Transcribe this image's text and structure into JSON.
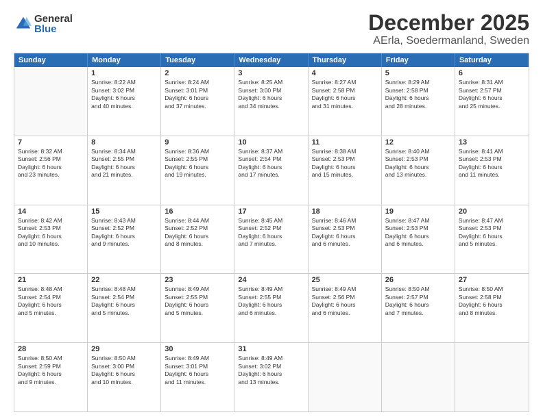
{
  "logo": {
    "general": "General",
    "blue": "Blue"
  },
  "title": "December 2025",
  "subtitle": "AErla, Soedermanland, Sweden",
  "headers": [
    "Sunday",
    "Monday",
    "Tuesday",
    "Wednesday",
    "Thursday",
    "Friday",
    "Saturday"
  ],
  "weeks": [
    [
      {
        "day": "",
        "info": ""
      },
      {
        "day": "1",
        "info": "Sunrise: 8:22 AM\nSunset: 3:02 PM\nDaylight: 6 hours\nand 40 minutes."
      },
      {
        "day": "2",
        "info": "Sunrise: 8:24 AM\nSunset: 3:01 PM\nDaylight: 6 hours\nand 37 minutes."
      },
      {
        "day": "3",
        "info": "Sunrise: 8:25 AM\nSunset: 3:00 PM\nDaylight: 6 hours\nand 34 minutes."
      },
      {
        "day": "4",
        "info": "Sunrise: 8:27 AM\nSunset: 2:58 PM\nDaylight: 6 hours\nand 31 minutes."
      },
      {
        "day": "5",
        "info": "Sunrise: 8:29 AM\nSunset: 2:58 PM\nDaylight: 6 hours\nand 28 minutes."
      },
      {
        "day": "6",
        "info": "Sunrise: 8:31 AM\nSunset: 2:57 PM\nDaylight: 6 hours\nand 25 minutes."
      }
    ],
    [
      {
        "day": "7",
        "info": "Sunrise: 8:32 AM\nSunset: 2:56 PM\nDaylight: 6 hours\nand 23 minutes."
      },
      {
        "day": "8",
        "info": "Sunrise: 8:34 AM\nSunset: 2:55 PM\nDaylight: 6 hours\nand 21 minutes."
      },
      {
        "day": "9",
        "info": "Sunrise: 8:36 AM\nSunset: 2:55 PM\nDaylight: 6 hours\nand 19 minutes."
      },
      {
        "day": "10",
        "info": "Sunrise: 8:37 AM\nSunset: 2:54 PM\nDaylight: 6 hours\nand 17 minutes."
      },
      {
        "day": "11",
        "info": "Sunrise: 8:38 AM\nSunset: 2:53 PM\nDaylight: 6 hours\nand 15 minutes."
      },
      {
        "day": "12",
        "info": "Sunrise: 8:40 AM\nSunset: 2:53 PM\nDaylight: 6 hours\nand 13 minutes."
      },
      {
        "day": "13",
        "info": "Sunrise: 8:41 AM\nSunset: 2:53 PM\nDaylight: 6 hours\nand 11 minutes."
      }
    ],
    [
      {
        "day": "14",
        "info": "Sunrise: 8:42 AM\nSunset: 2:53 PM\nDaylight: 6 hours\nand 10 minutes."
      },
      {
        "day": "15",
        "info": "Sunrise: 8:43 AM\nSunset: 2:52 PM\nDaylight: 6 hours\nand 9 minutes."
      },
      {
        "day": "16",
        "info": "Sunrise: 8:44 AM\nSunset: 2:52 PM\nDaylight: 6 hours\nand 8 minutes."
      },
      {
        "day": "17",
        "info": "Sunrise: 8:45 AM\nSunset: 2:52 PM\nDaylight: 6 hours\nand 7 minutes."
      },
      {
        "day": "18",
        "info": "Sunrise: 8:46 AM\nSunset: 2:53 PM\nDaylight: 6 hours\nand 6 minutes."
      },
      {
        "day": "19",
        "info": "Sunrise: 8:47 AM\nSunset: 2:53 PM\nDaylight: 6 hours\nand 6 minutes."
      },
      {
        "day": "20",
        "info": "Sunrise: 8:47 AM\nSunset: 2:53 PM\nDaylight: 6 hours\nand 5 minutes."
      }
    ],
    [
      {
        "day": "21",
        "info": "Sunrise: 8:48 AM\nSunset: 2:54 PM\nDaylight: 6 hours\nand 5 minutes."
      },
      {
        "day": "22",
        "info": "Sunrise: 8:48 AM\nSunset: 2:54 PM\nDaylight: 6 hours\nand 5 minutes."
      },
      {
        "day": "23",
        "info": "Sunrise: 8:49 AM\nSunset: 2:55 PM\nDaylight: 6 hours\nand 5 minutes."
      },
      {
        "day": "24",
        "info": "Sunrise: 8:49 AM\nSunset: 2:55 PM\nDaylight: 6 hours\nand 6 minutes."
      },
      {
        "day": "25",
        "info": "Sunrise: 8:49 AM\nSunset: 2:56 PM\nDaylight: 6 hours\nand 6 minutes."
      },
      {
        "day": "26",
        "info": "Sunrise: 8:50 AM\nSunset: 2:57 PM\nDaylight: 6 hours\nand 7 minutes."
      },
      {
        "day": "27",
        "info": "Sunrise: 8:50 AM\nSunset: 2:58 PM\nDaylight: 6 hours\nand 8 minutes."
      }
    ],
    [
      {
        "day": "28",
        "info": "Sunrise: 8:50 AM\nSunset: 2:59 PM\nDaylight: 6 hours\nand 9 minutes."
      },
      {
        "day": "29",
        "info": "Sunrise: 8:50 AM\nSunset: 3:00 PM\nDaylight: 6 hours\nand 10 minutes."
      },
      {
        "day": "30",
        "info": "Sunrise: 8:49 AM\nSunset: 3:01 PM\nDaylight: 6 hours\nand 11 minutes."
      },
      {
        "day": "31",
        "info": "Sunrise: 8:49 AM\nSunset: 3:02 PM\nDaylight: 6 hours\nand 13 minutes."
      },
      {
        "day": "",
        "info": ""
      },
      {
        "day": "",
        "info": ""
      },
      {
        "day": "",
        "info": ""
      }
    ]
  ]
}
